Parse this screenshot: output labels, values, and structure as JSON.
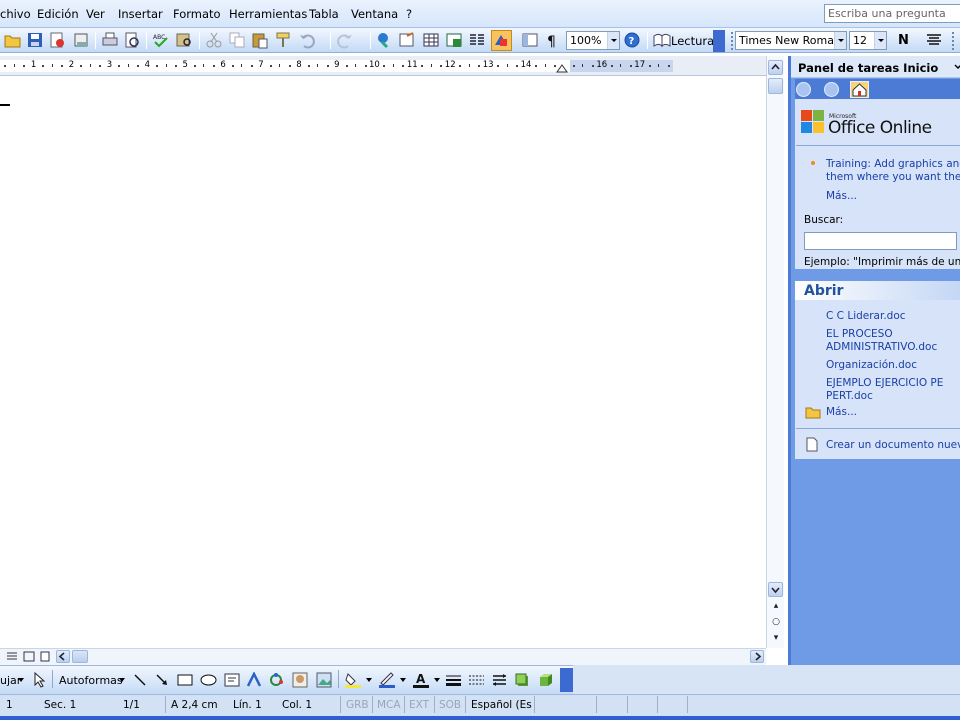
{
  "menu": {
    "items": [
      "chivo",
      "Edición",
      "Ver",
      "Insertar",
      "Formato",
      "Herramientas",
      "Tabla",
      "Ventana",
      "?"
    ],
    "ask_placeholder": "Escriba una pregunta"
  },
  "toolbar": {
    "zoom": "100%",
    "reading_label": "Lectura",
    "font_name": "Times New Roman",
    "font_size": "12",
    "bold_label": "N"
  },
  "ruler": {
    "numbers": [
      "1",
      "2",
      "3",
      "4",
      "5",
      "6",
      "7",
      "8",
      "9",
      "10",
      "11",
      "12",
      "13",
      "14",
      "16",
      "17"
    ]
  },
  "task_pane": {
    "title": "Panel de tareas Inicio",
    "office_online_small": "Microsoft",
    "office_online": "Office Online",
    "training_line1": "Training: Add graphics and k",
    "training_line2": "them where you want them",
    "more_1": "Más...",
    "search_label": "Buscar:",
    "example_text": "Ejemplo: \"Imprimir más de una co",
    "open_heading": "Abrir",
    "recent_files": [
      [
        "C C Liderar.doc"
      ],
      [
        "EL PROCESO",
        "ADMINISTRATIVO.doc"
      ],
      [
        "Organización.doc"
      ],
      [
        "EJEMPLO EJERCICIO PE",
        "PERT.doc"
      ]
    ],
    "more_2": "Más...",
    "new_document": "Crear un documento nuevo..."
  },
  "drawing_toolbar": {
    "draw_label": "ujar",
    "autoshapes_label": "Autoformas"
  },
  "status_bar": {
    "page": "1",
    "section": "Sec. 1",
    "pages": "1/1",
    "position": "A 2,4 cm",
    "line": "Lín. 1",
    "column": "Col. 1",
    "rec": "GRB",
    "trk": "MCA",
    "ext": "EXT",
    "ovr": "SOB",
    "language": "Español (Es"
  },
  "colors": {
    "pane_blue": "#6f9be6",
    "pane_section": "#d6e3f8",
    "link": "#1a3fa6",
    "toolbar_top": "#f2f7fe",
    "toolbar_bottom": "#c4daf6"
  }
}
